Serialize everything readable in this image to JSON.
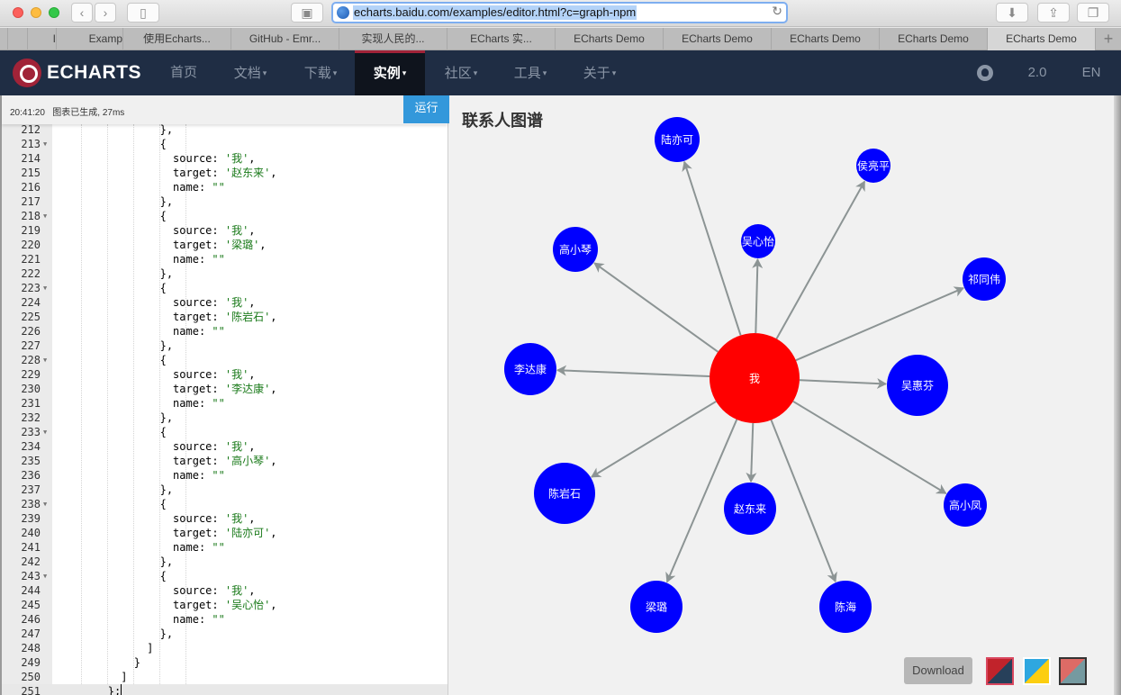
{
  "browser": {
    "url": "echarts.baidu.com/examples/editor.html?c=graph-npm",
    "tabs": [
      {
        "label": ""
      },
      {
        "label": "I"
      },
      {
        "label": "Examp"
      },
      {
        "label": "使用Echarts..."
      },
      {
        "label": "GitHub - Emr..."
      },
      {
        "label": "实现人民的..."
      },
      {
        "label": "ECharts 实..."
      },
      {
        "label": "ECharts Demo"
      },
      {
        "label": "ECharts Demo"
      },
      {
        "label": "ECharts Demo"
      },
      {
        "label": "ECharts Demo"
      },
      {
        "label": "ECharts Demo"
      }
    ],
    "active_tab": 11,
    "icons": {
      "back": "chevron-left-icon",
      "forward": "chevron-right-icon",
      "sidebar": "sidebar-icon",
      "reader": "reader-icon",
      "reload": "reload-icon",
      "downloads": "download-icon",
      "share": "share-icon",
      "tabs": "tabs-icon",
      "new_tab": "plus-icon"
    }
  },
  "nav": {
    "logo_text": "ECHARTS",
    "items": [
      {
        "label": "首页",
        "caret": ""
      },
      {
        "label": "文档",
        "caret": "▾"
      },
      {
        "label": "下载",
        "caret": "▾"
      },
      {
        "label": "实例",
        "caret": "▾"
      },
      {
        "label": "社区",
        "caret": "▾"
      },
      {
        "label": "工具",
        "caret": "▾"
      },
      {
        "label": "关于",
        "caret": "▾"
      }
    ],
    "active_item": 3,
    "version": "2.0",
    "language": "EN",
    "accent_color": "#a12338"
  },
  "editor": {
    "status_time": "20:41:20",
    "status_text": "图表已生成, 27ms",
    "run_label": "运行",
    "lines": [
      {
        "n": "212",
        "fold": false,
        "code": "                },"
      },
      {
        "n": "213",
        "fold": true,
        "code": "                {"
      },
      {
        "n": "214",
        "fold": false,
        "code": "                  source: ",
        "str": "'我'",
        "tail": ","
      },
      {
        "n": "215",
        "fold": false,
        "code": "                  target: ",
        "str": "'赵东来'",
        "tail": ","
      },
      {
        "n": "216",
        "fold": false,
        "code": "                  name: ",
        "str": "\"\"",
        "tail": ""
      },
      {
        "n": "217",
        "fold": false,
        "code": "                },"
      },
      {
        "n": "218",
        "fold": true,
        "code": "                {"
      },
      {
        "n": "219",
        "fold": false,
        "code": "                  source: ",
        "str": "'我'",
        "tail": ","
      },
      {
        "n": "220",
        "fold": false,
        "code": "                  target: ",
        "str": "'梁璐'",
        "tail": ","
      },
      {
        "n": "221",
        "fold": false,
        "code": "                  name: ",
        "str": "\"\"",
        "tail": ""
      },
      {
        "n": "222",
        "fold": false,
        "code": "                },"
      },
      {
        "n": "223",
        "fold": true,
        "code": "                {"
      },
      {
        "n": "224",
        "fold": false,
        "code": "                  source: ",
        "str": "'我'",
        "tail": ","
      },
      {
        "n": "225",
        "fold": false,
        "code": "                  target: ",
        "str": "'陈岩石'",
        "tail": ","
      },
      {
        "n": "226",
        "fold": false,
        "code": "                  name: ",
        "str": "\"\"",
        "tail": ""
      },
      {
        "n": "227",
        "fold": false,
        "code": "                },"
      },
      {
        "n": "228",
        "fold": true,
        "code": "                {"
      },
      {
        "n": "229",
        "fold": false,
        "code": "                  source: ",
        "str": "'我'",
        "tail": ","
      },
      {
        "n": "230",
        "fold": false,
        "code": "                  target: ",
        "str": "'李达康'",
        "tail": ","
      },
      {
        "n": "231",
        "fold": false,
        "code": "                  name: ",
        "str": "\"\"",
        "tail": ""
      },
      {
        "n": "232",
        "fold": false,
        "code": "                },"
      },
      {
        "n": "233",
        "fold": true,
        "code": "                {"
      },
      {
        "n": "234",
        "fold": false,
        "code": "                  source: ",
        "str": "'我'",
        "tail": ","
      },
      {
        "n": "235",
        "fold": false,
        "code": "                  target: ",
        "str": "'高小琴'",
        "tail": ","
      },
      {
        "n": "236",
        "fold": false,
        "code": "                  name: ",
        "str": "\"\"",
        "tail": ""
      },
      {
        "n": "237",
        "fold": false,
        "code": "                },"
      },
      {
        "n": "238",
        "fold": true,
        "code": "                {"
      },
      {
        "n": "239",
        "fold": false,
        "code": "                  source: ",
        "str": "'我'",
        "tail": ","
      },
      {
        "n": "240",
        "fold": false,
        "code": "                  target: ",
        "str": "'陆亦可'",
        "tail": ","
      },
      {
        "n": "241",
        "fold": false,
        "code": "                  name: ",
        "str": "\"\"",
        "tail": ""
      },
      {
        "n": "242",
        "fold": false,
        "code": "                },"
      },
      {
        "n": "243",
        "fold": true,
        "code": "                {"
      },
      {
        "n": "244",
        "fold": false,
        "code": "                  source: ",
        "str": "'我'",
        "tail": ","
      },
      {
        "n": "245",
        "fold": false,
        "code": "                  target: ",
        "str": "'吴心怡'",
        "tail": ","
      },
      {
        "n": "246",
        "fold": false,
        "code": "                  name: ",
        "str": "\"\"",
        "tail": ""
      },
      {
        "n": "247",
        "fold": false,
        "code": "                },"
      },
      {
        "n": "248",
        "fold": false,
        "code": "              ]"
      },
      {
        "n": "249",
        "fold": false,
        "code": "            }"
      },
      {
        "n": "250",
        "fold": false,
        "code": "          ]"
      },
      {
        "n": "251",
        "fold": false,
        "code": "        };",
        "current": true
      }
    ]
  },
  "chart_data": {
    "type": "graph",
    "title": "联系人图谱",
    "center": {
      "name": "我",
      "color": "#ff0000"
    },
    "node_color": "#0000ff",
    "edge_color": "#8c9494",
    "nodes": [
      {
        "name": "我",
        "category": "center"
      },
      {
        "name": "陆亦可"
      },
      {
        "name": "侯亮平"
      },
      {
        "name": "吴心怡"
      },
      {
        "name": "高小琴"
      },
      {
        "name": "祁同伟"
      },
      {
        "name": "李达康"
      },
      {
        "name": "吴惠芬"
      },
      {
        "name": "陈岩石"
      },
      {
        "name": "赵东来"
      },
      {
        "name": "高小凤"
      },
      {
        "name": "梁璐"
      },
      {
        "name": "陈海"
      }
    ],
    "links": [
      {
        "source": "我",
        "target": "陆亦可"
      },
      {
        "source": "我",
        "target": "侯亮平"
      },
      {
        "source": "我",
        "target": "吴心怡"
      },
      {
        "source": "我",
        "target": "高小琴"
      },
      {
        "source": "我",
        "target": "祁同伟"
      },
      {
        "source": "我",
        "target": "李达康"
      },
      {
        "source": "我",
        "target": "吴惠芬"
      },
      {
        "source": "我",
        "target": "陈岩石"
      },
      {
        "source": "我",
        "target": "赵东来"
      },
      {
        "source": "我",
        "target": "高小凤"
      },
      {
        "source": "我",
        "target": "梁璐"
      },
      {
        "source": "我",
        "target": "陈海"
      }
    ]
  },
  "toolbar": {
    "download_label": "Download",
    "themes": [
      "theme-default",
      "theme-light",
      "theme-dark"
    ],
    "selected_theme": 0
  }
}
